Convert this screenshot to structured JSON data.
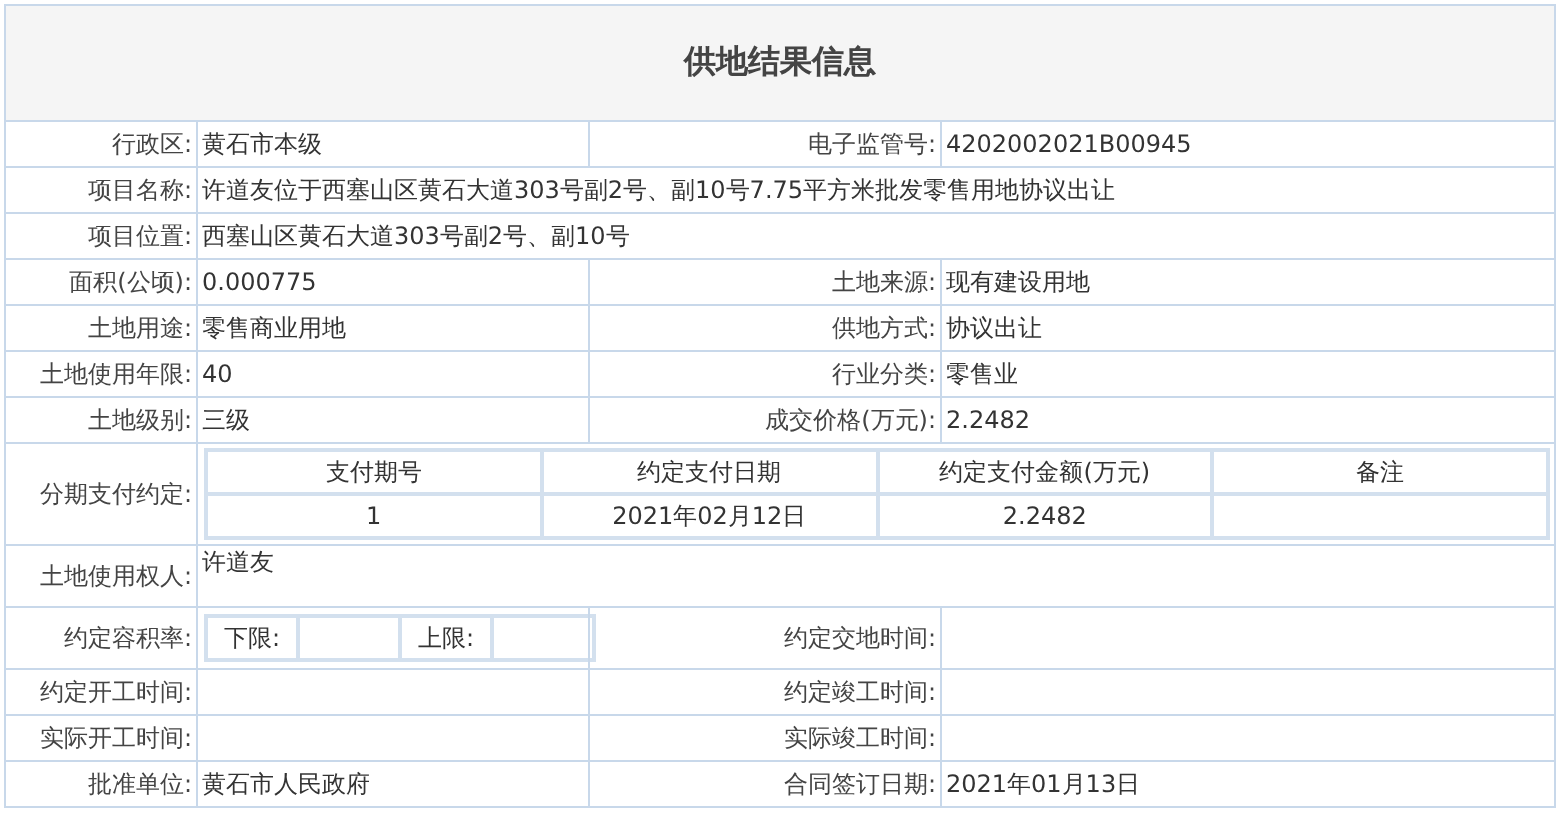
{
  "title": "供地结果信息",
  "rows": [
    {
      "kind": "pair",
      "label": "行政区:",
      "value": "黄石市本级",
      "label2": "电子监管号:",
      "value2": "4202002021B00945"
    },
    {
      "kind": "wide",
      "label": "项目名称:",
      "value": "许道友位于西塞山区黄石大道303号副2号、副10号7.75平方米批发零售用地协议出让"
    },
    {
      "kind": "wide",
      "label": "项目位置:",
      "value": "西塞山区黄石大道303号副2号、副10号"
    },
    {
      "kind": "pair",
      "label": "面积(公顷):",
      "value": "0.000775",
      "label2": "土地来源:",
      "value2": "现有建设用地"
    },
    {
      "kind": "pair",
      "label": "土地用途:",
      "value": "零售商业用地",
      "label2": "供地方式:",
      "value2": "协议出让"
    },
    {
      "kind": "pair",
      "label": "土地使用年限:",
      "value": "40",
      "label2": "行业分类:",
      "value2": "零售业"
    },
    {
      "kind": "pair",
      "label": "土地级别:",
      "value": "三级",
      "label2": "成交价格(万元):",
      "value2": "2.2482"
    },
    {
      "kind": "payment",
      "label": "分期支付约定:",
      "columns": [
        "支付期号",
        "约定支付日期",
        "约定支付金额(万元)",
        "备注"
      ],
      "entries": [
        [
          "1",
          "2021年02月12日",
          "2.2482"
        ]
      ]
    },
    {
      "kind": "tall",
      "label": "土地使用权人:",
      "value": "许道友"
    },
    {
      "kind": "ratio",
      "label": "约定容积率:",
      "lower": "下限:",
      "upper": "上限:",
      "label2": "约定交地时间:"
    },
    {
      "kind": "pair",
      "label": "约定开工时间:",
      "label2": "约定竣工时间:"
    },
    {
      "kind": "pair",
      "label": "实际开工时间:",
      "label2": "实际竣工时间:"
    },
    {
      "kind": "pair",
      "label": "批准单位:",
      "value": "黄石市人民政府",
      "label2": "合同签订日期:",
      "value2": "2021年01月13日"
    }
  ]
}
